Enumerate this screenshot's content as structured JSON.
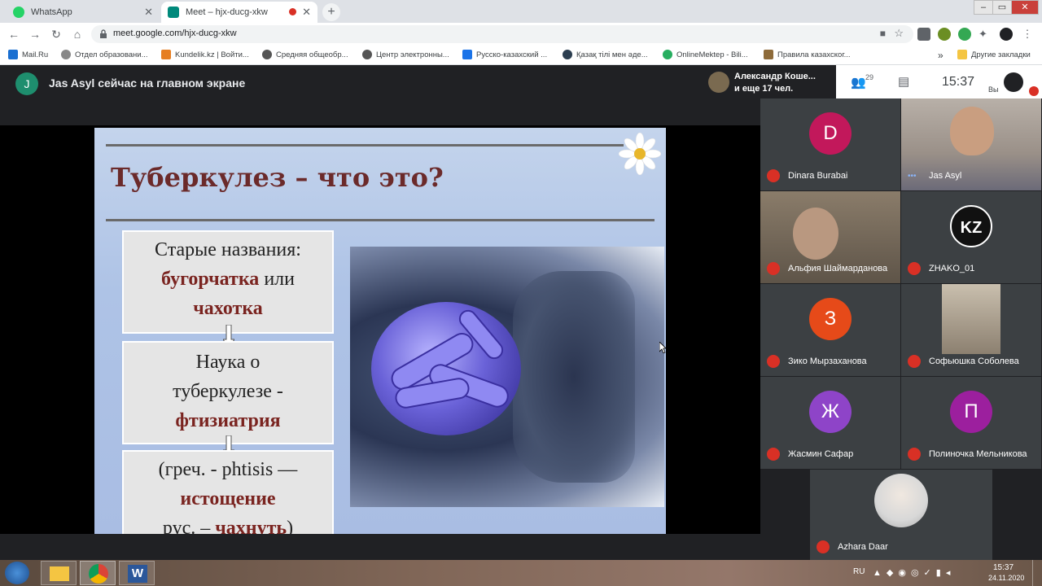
{
  "browser": {
    "tabs": [
      {
        "title": "WhatsApp",
        "active": false,
        "icon": "whatsapp-icon",
        "color": "#25d366"
      },
      {
        "title": "Meet – hjx-ducg-xkw",
        "active": true,
        "icon": "meet-icon",
        "color": "#00897b"
      }
    ],
    "url": "meet.google.com/hjx-ducg-xkw",
    "bookmarks": [
      {
        "label": "Mail.Ru",
        "color": "#1a6fd1"
      },
      {
        "label": "Отдел образовани...",
        "color": "#888888"
      },
      {
        "label": "Kundelik.kz | Войти...",
        "color": "#e67e22"
      },
      {
        "label": "Средняя общеобр...",
        "color": "#555555"
      },
      {
        "label": "Центр электронны...",
        "color": "#555555"
      },
      {
        "label": "Русско-казахский ...",
        "color": "#1a73e8"
      },
      {
        "label": "Қазақ тілі мен әде...",
        "color": "#2c3e50"
      },
      {
        "label": "OnlineMektep - Bili...",
        "color": "#27ae60"
      },
      {
        "label": "Правила казахског...",
        "color": "#8e6b3a"
      }
    ],
    "bookmarks_more": "»",
    "other_bookmarks": "Другие закладки"
  },
  "meet": {
    "presenter_initial": "J",
    "presenting_text": "Jas Asyl сейчас на главном экране",
    "others_name": "Александр Коше...",
    "others_count_text": "и еще 17 чел.",
    "people_count": "29",
    "clock": "15:37",
    "self_label": "Вы"
  },
  "slide": {
    "title": "Туберкулез – что это?",
    "box1": {
      "line1": "Старые названия:",
      "accent1": "бугорчатка",
      "mid": " или",
      "accent2": "чахотка"
    },
    "box2": {
      "line1": "Наука о",
      "line2": "туберкулезе -",
      "accent": "фтизиатрия"
    },
    "box3": {
      "line1": "(греч. -  phtisis —",
      "accent1": "истощение",
      "line3a": "рус. – ",
      "accent2": "чахнуть",
      "line3b": ")"
    }
  },
  "participants": [
    {
      "name": "Dinara Burabai",
      "initial": "D",
      "color": "#c2185b",
      "type": "letter",
      "muted": true
    },
    {
      "name": "Jas Asyl",
      "initial": "",
      "color": "#b8b0a8",
      "type": "video",
      "muted": false
    },
    {
      "name": "Альфия Шаймарданова",
      "initial": "",
      "color": "#8a7c6a",
      "type": "video",
      "muted": true
    },
    {
      "name": "ZHAKO_01",
      "initial": "KZ",
      "color": "#111111",
      "type": "letter",
      "muted": true
    },
    {
      "name": "Зико Мырзаханова",
      "initial": "З",
      "color": "#e64a19",
      "type": "letter",
      "muted": true
    },
    {
      "name": "Софьюшка Соболева",
      "initial": "",
      "color": "#c9bfae",
      "type": "video",
      "muted": true
    },
    {
      "name": "Жасмин Сафар",
      "initial": "Ж",
      "color": "#8e44c8",
      "type": "letter",
      "muted": true
    },
    {
      "name": "Полиночка Мельникова",
      "initial": "П",
      "color": "#9c1f9e",
      "type": "letter",
      "muted": true
    },
    {
      "name": "Azhara Daar",
      "initial": "",
      "color": "#d8d8d8",
      "type": "photo",
      "muted": true
    }
  ],
  "taskbar": {
    "lang": "RU",
    "time": "15:37",
    "date": "24.11.2020"
  }
}
